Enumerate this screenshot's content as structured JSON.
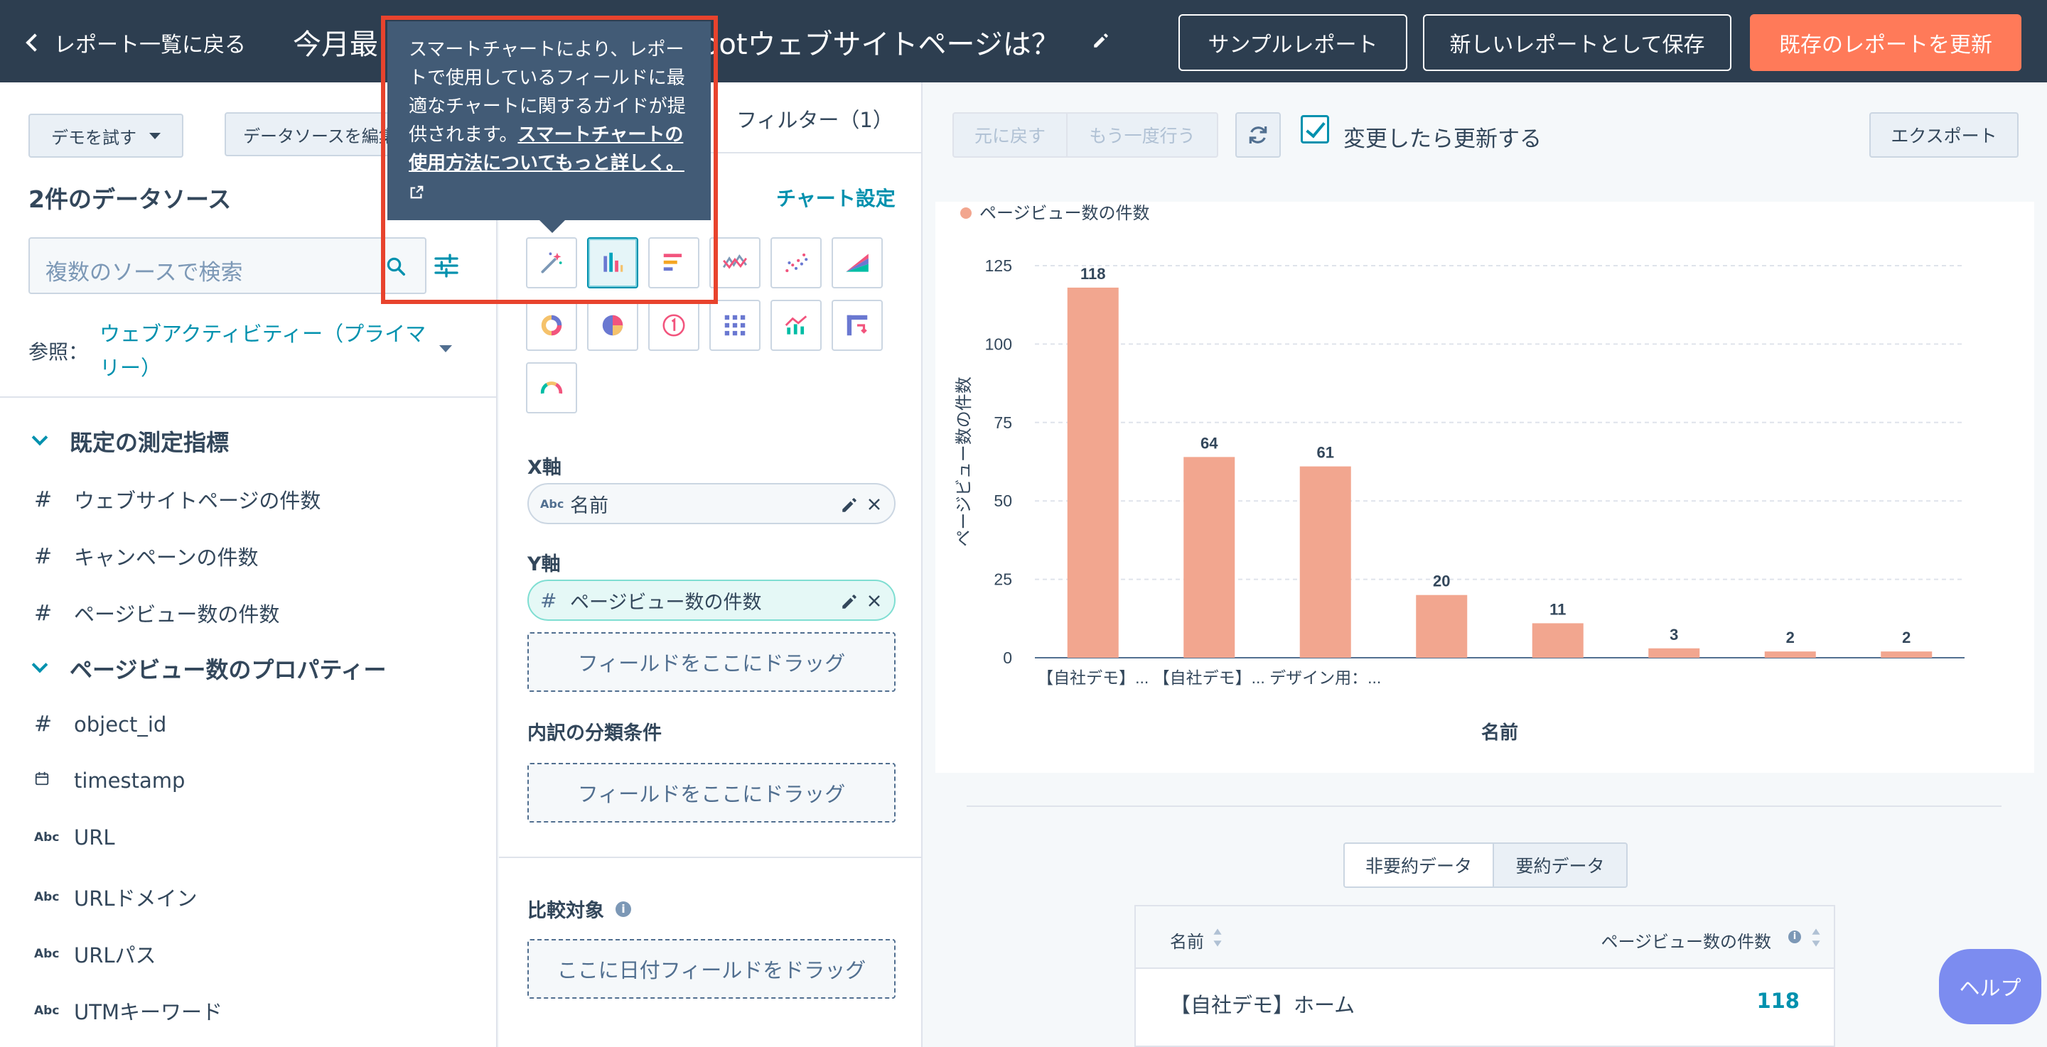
{
  "topbar": {
    "back_label": "レポート一覧に戻る",
    "title_left": "今月最",
    "title_right": "potウェブサイトページは？",
    "sample_report": "サンプルレポート",
    "save_new": "新しいレポートとして保存",
    "update_existing": "既存のレポートを更新"
  },
  "left": {
    "demo_button": "デモを試す",
    "datasource_edit": "データソースを編集",
    "datasource_title": "2件のデータソース",
    "search_placeholder": "複数のソースで検索",
    "reference_label": "参照：",
    "reference_value": "ウェブアクティビティー（プライマリー）",
    "groups": [
      {
        "label": "既定の測定指標",
        "fields": [
          {
            "type": "#",
            "label": "ウェブサイトページの件数"
          },
          {
            "type": "#",
            "label": "キャンペーンの件数"
          },
          {
            "type": "#",
            "label": "ページビュー数の件数"
          }
        ]
      },
      {
        "label": "ページビュー数のプロパティー",
        "fields": [
          {
            "type": "#",
            "label": "object_id"
          },
          {
            "type": "date",
            "label": "timestamp"
          },
          {
            "type": "Abc",
            "label": "URL"
          },
          {
            "type": "Abc",
            "label": "URLドメイン"
          },
          {
            "type": "Abc",
            "label": "URLパス"
          },
          {
            "type": "Abc",
            "label": "UTMキーワード"
          }
        ]
      }
    ]
  },
  "middle": {
    "tab_filter": "フィルター（1）",
    "chart_settings": "チャート設定",
    "x_axis_label": "X軸",
    "x_axis_field": "名前",
    "x_axis_type": "Abc",
    "y_axis_label": "Y軸",
    "y_axis_field": "ページビュー数の件数",
    "y_axis_type": "#",
    "drag_here": "フィールドをここにドラッグ",
    "breakdown_label": "内訳の分類条件",
    "breakdown_drop": "フィールドをここにドラッグ",
    "compare_label": "比較対象",
    "compare_drop": "ここに日付フィールドをドラッグ"
  },
  "tooltip": {
    "text": "スマートチャートにより、レポートで使用しているフィールドに最適なチャートに関するガイドが提供されます。",
    "link": "スマートチャートの使用方法についてもっと詳しく。"
  },
  "right": {
    "undo": "元に戻す",
    "redo": "もう一度行う",
    "auto_update": "変更したら更新する",
    "export": "エクスポート",
    "toggle_unsummarized": "非要約データ",
    "toggle_summarized": "要約データ",
    "table": {
      "col_name": "名前",
      "col_count": "ページビュー数の件数",
      "rows": [
        {
          "name": "【自社デモ】ホーム",
          "count": "118"
        }
      ]
    },
    "help": "ヘルプ"
  },
  "colors": {
    "accent": "#ff7a59",
    "bar": "#f2a68f",
    "teal": "#0091ae",
    "topbar": "#2d3e50"
  },
  "chart_data": {
    "type": "bar",
    "legend": [
      "ページビュー数の件数"
    ],
    "categories": [
      "【自社デモ】...",
      "【自社デモ】...",
      "デザイン用：...",
      "",
      "",
      "",
      "",
      ""
    ],
    "values": [
      118,
      64,
      61,
      20,
      11,
      3,
      2,
      2
    ],
    "xlabel": "名前",
    "ylabel": "ページビュー数の件数",
    "ylim": [
      0,
      125
    ],
    "yticks": [
      0,
      25,
      50,
      75,
      100,
      125
    ],
    "grid": true
  }
}
